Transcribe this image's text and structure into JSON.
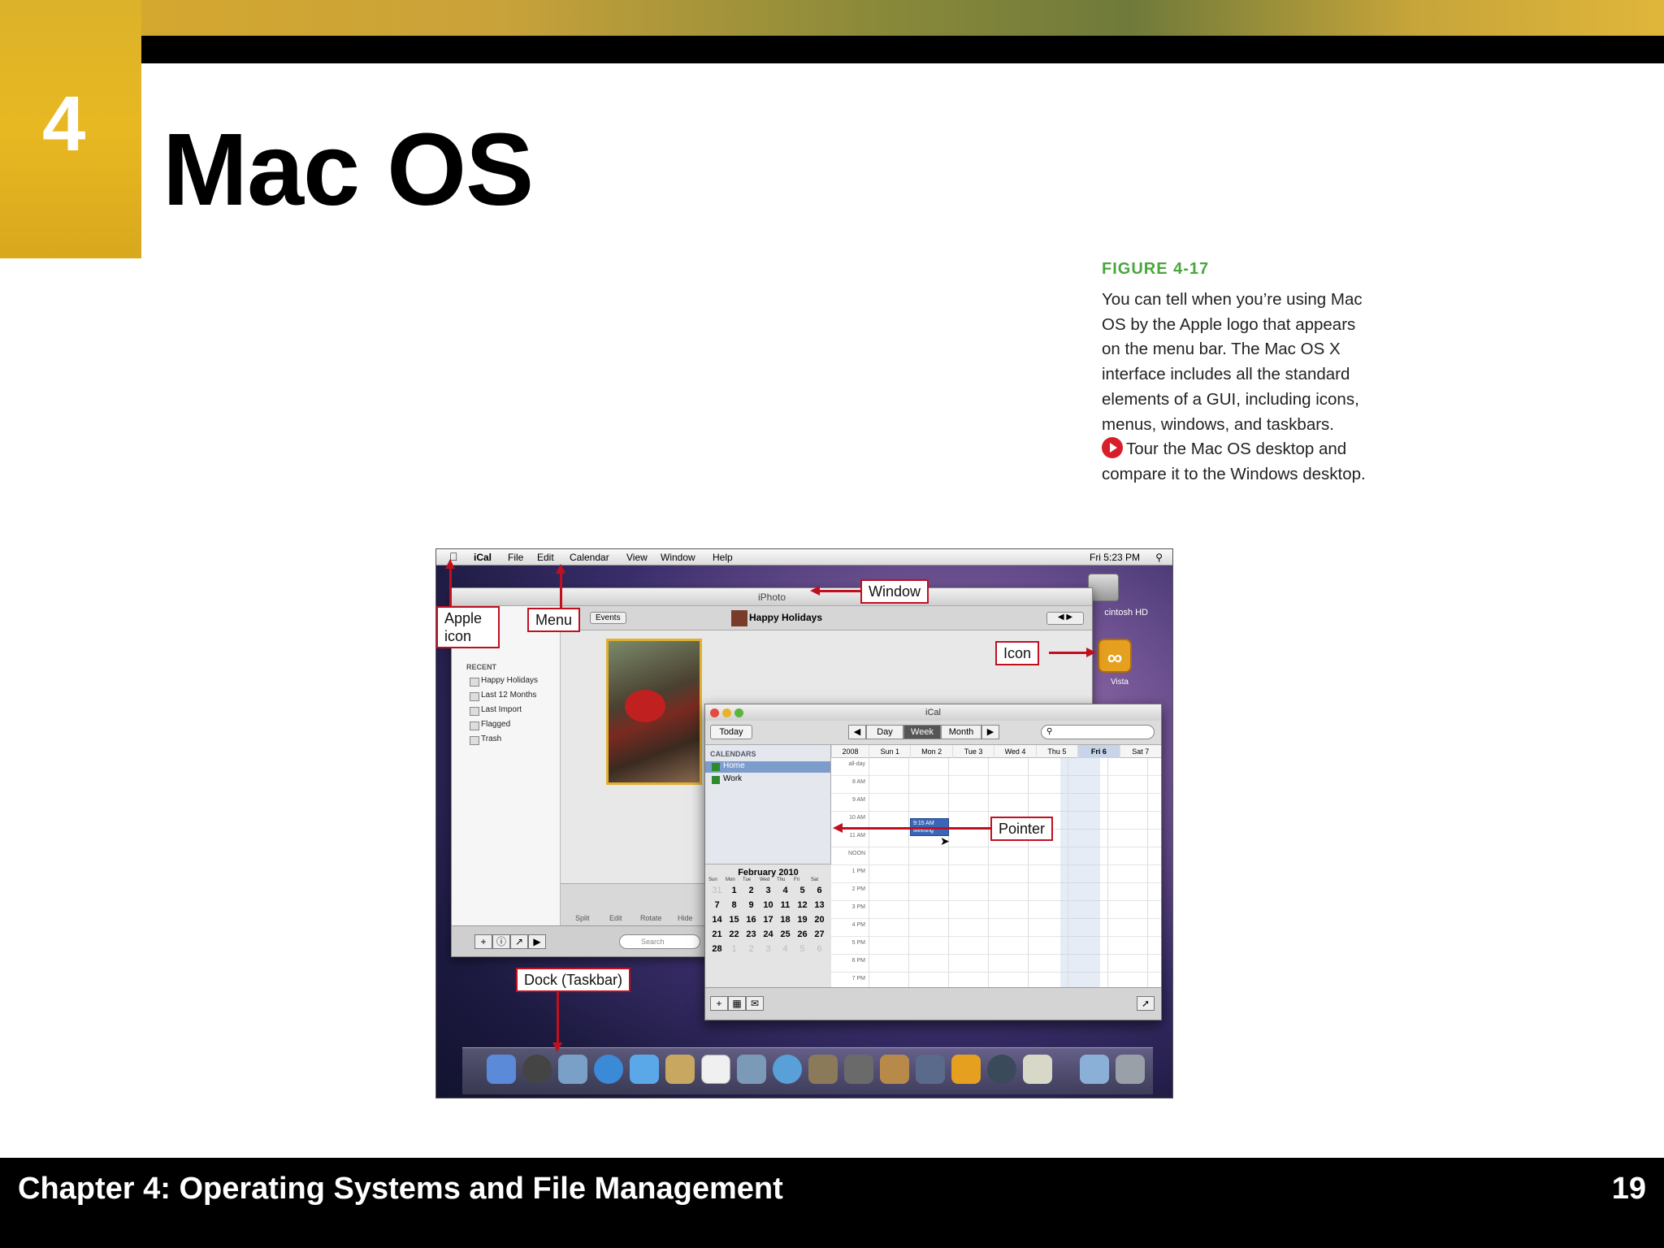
{
  "slide": {
    "chapter_number": "4",
    "title": "Mac OS",
    "footer_title": "Chapter 4: Operating Systems and File Management",
    "page_number": "19"
  },
  "caption": {
    "figure_label": "FIGURE 4-17",
    "paragraph": "You can tell when you’re using Mac OS by the Apple logo that appears on the menu bar. The Mac OS X interface includes all the standard elements of a GUI, including icons, menus, windows, and taskbars.",
    "tour_text": "Tour the Mac OS desktop and compare it to the Windows desktop."
  },
  "screenshot": {
    "menubar": {
      "items": [
        "iCal",
        "File",
        "Edit",
        "Calendar",
        "View",
        "Window",
        "Help"
      ],
      "clock": "Fri 5:23 PM"
    },
    "desktop": {
      "hd_label": "cintosh HD",
      "vista_label": "Vista"
    },
    "iphoto": {
      "title": "iPhoto",
      "events_button": "Events",
      "album_title": "Happy Holidays",
      "recent_header": "RECENT",
      "sidebar_items": [
        "Happy Holidays",
        "Last 12 Months",
        "Last Import",
        "Flagged",
        "Trash"
      ],
      "tools": [
        "Split",
        "Edit",
        "Rotate",
        "Hide"
      ],
      "search_placeholder": "Search"
    },
    "ical": {
      "title": "iCal",
      "today": "Today",
      "views": [
        "Day",
        "Week",
        "Month"
      ],
      "active_view": "Week",
      "calendars_header": "CALENDARS",
      "calendars": [
        "Home",
        "Work"
      ],
      "year": "2008",
      "week_days": [
        "Sun 1",
        "Mon 2",
        "Tue 3",
        "Wed 4",
        "Thu 5",
        "Fri 6",
        "Sat 7"
      ],
      "all_day": "all-day",
      "hours": [
        "8 AM",
        "9 AM",
        "10 AM",
        "11 AM",
        "NOON",
        "1 PM",
        "2 PM",
        "3 PM",
        "4 PM",
        "5 PM",
        "6 PM",
        "7 PM"
      ],
      "event_time": "9:15 AM",
      "event_title": "Meeting",
      "mini_month": "February 2010",
      "mini_dow": [
        "Sun",
        "Mon",
        "Tue",
        "Wed",
        "Thu",
        "Fri",
        "Sat"
      ]
    },
    "callouts": {
      "window": "Window",
      "apple_icon": "Apple icon",
      "menu": "Menu",
      "icon": "Icon",
      "pointer": "Pointer",
      "dock": "Dock (Taskbar)"
    }
  }
}
